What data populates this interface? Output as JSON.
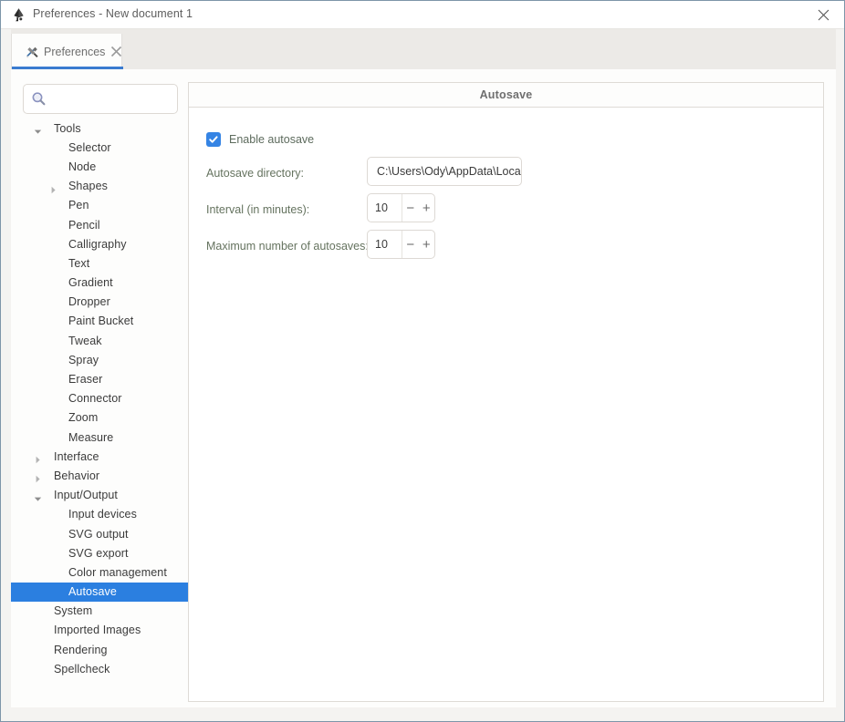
{
  "window": {
    "title": "Preferences - New document 1",
    "app_icon": "inkscape-logo-icon",
    "close_icon": "window-close-icon"
  },
  "tab": {
    "label": "Preferences",
    "icon": "preferences-tools-icon",
    "close_icon": "tab-close-icon",
    "accent_color": "#3a7bd0"
  },
  "search": {
    "value": "",
    "placeholder": "",
    "icon": "search-icon"
  },
  "tree": {
    "selected": "Autosave",
    "selection_color": "#2b7fe0",
    "items": [
      {
        "label": "Tools",
        "depth": 0,
        "arrow": "expanded",
        "selected": false
      },
      {
        "label": "Selector",
        "depth": 1,
        "arrow": "none",
        "selected": false
      },
      {
        "label": "Node",
        "depth": 1,
        "arrow": "none",
        "selected": false
      },
      {
        "label": "Shapes",
        "depth": 1,
        "arrow": "collapsed",
        "selected": false
      },
      {
        "label": "Pen",
        "depth": 1,
        "arrow": "none",
        "selected": false
      },
      {
        "label": "Pencil",
        "depth": 1,
        "arrow": "none",
        "selected": false
      },
      {
        "label": "Calligraphy",
        "depth": 1,
        "arrow": "none",
        "selected": false
      },
      {
        "label": "Text",
        "depth": 1,
        "arrow": "none",
        "selected": false
      },
      {
        "label": "Gradient",
        "depth": 1,
        "arrow": "none",
        "selected": false
      },
      {
        "label": "Dropper",
        "depth": 1,
        "arrow": "none",
        "selected": false
      },
      {
        "label": "Paint Bucket",
        "depth": 1,
        "arrow": "none",
        "selected": false
      },
      {
        "label": "Tweak",
        "depth": 1,
        "arrow": "none",
        "selected": false
      },
      {
        "label": "Spray",
        "depth": 1,
        "arrow": "none",
        "selected": false
      },
      {
        "label": "Eraser",
        "depth": 1,
        "arrow": "none",
        "selected": false
      },
      {
        "label": "Connector",
        "depth": 1,
        "arrow": "none",
        "selected": false
      },
      {
        "label": "Zoom",
        "depth": 1,
        "arrow": "none",
        "selected": false
      },
      {
        "label": "Measure",
        "depth": 1,
        "arrow": "none",
        "selected": false
      },
      {
        "label": "Interface",
        "depth": 0,
        "arrow": "collapsed",
        "selected": false
      },
      {
        "label": "Behavior",
        "depth": 0,
        "arrow": "collapsed",
        "selected": false
      },
      {
        "label": "Input/Output",
        "depth": 0,
        "arrow": "expanded",
        "selected": false
      },
      {
        "label": "Input devices",
        "depth": 1,
        "arrow": "none",
        "selected": false
      },
      {
        "label": "SVG output",
        "depth": 1,
        "arrow": "none",
        "selected": false
      },
      {
        "label": "SVG export",
        "depth": 1,
        "arrow": "none",
        "selected": false
      },
      {
        "label": "Color management",
        "depth": 1,
        "arrow": "none",
        "selected": false
      },
      {
        "label": "Autosave",
        "depth": 1,
        "arrow": "none",
        "selected": true
      },
      {
        "label": "System",
        "depth": 0,
        "arrow": "none",
        "selected": false
      },
      {
        "label": "Imported Images",
        "depth": 0,
        "arrow": "none",
        "selected": false
      },
      {
        "label": "Rendering",
        "depth": 0,
        "arrow": "none",
        "selected": false
      },
      {
        "label": "Spellcheck",
        "depth": 0,
        "arrow": "none",
        "selected": false
      }
    ]
  },
  "panel": {
    "title": "Autosave",
    "enable_checkbox": {
      "label": "Enable autosave",
      "checked": true,
      "color": "#3584e4"
    },
    "directory": {
      "label": "Autosave directory:",
      "value": "C:\\Users\\Ody\\AppData\\Loca"
    },
    "interval": {
      "label": "Interval (in minutes):",
      "value": "10",
      "decrement": "−",
      "increment": "+"
    },
    "max_autosaves": {
      "label": "Maximum number of autosaves:",
      "value": "10",
      "decrement": "−",
      "increment": "+"
    }
  }
}
